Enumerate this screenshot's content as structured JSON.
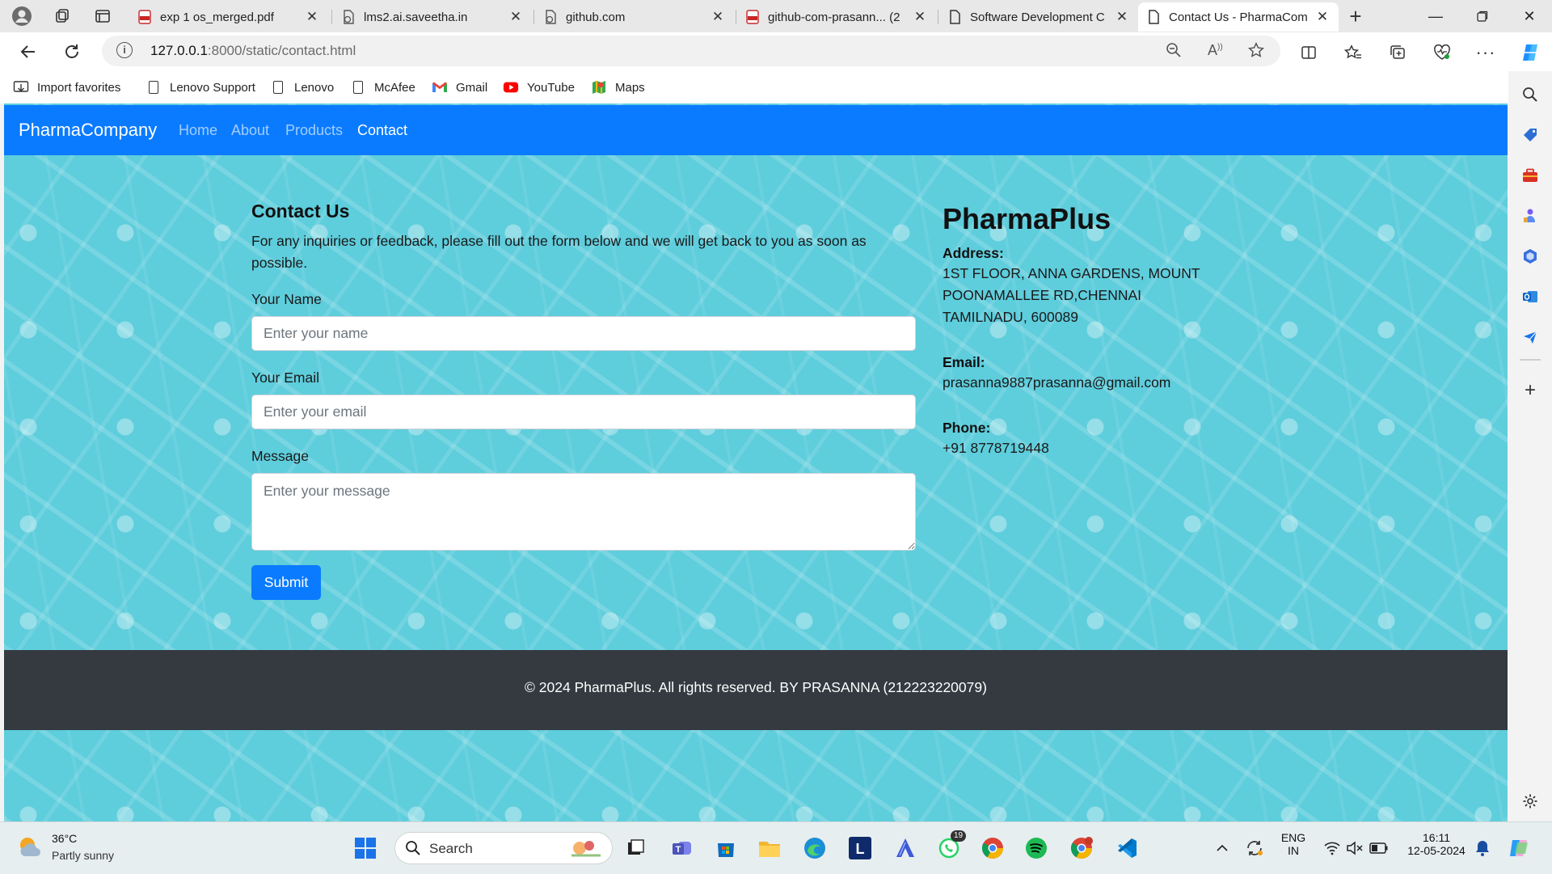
{
  "browser": {
    "tabs": [
      {
        "title": "exp 1 os_merged.pdf",
        "icon": "pdf-icon"
      },
      {
        "title": "lms2.ai.saveetha.in",
        "icon": "loading-page-icon"
      },
      {
        "title": "github.com",
        "icon": "loading-page-icon"
      },
      {
        "title": "github-com-prasann... (2",
        "icon": "pdf-icon"
      },
      {
        "title": "Software Development C",
        "icon": "page-icon"
      },
      {
        "title": "Contact Us - PharmaCom",
        "icon": "page-icon",
        "active": true
      }
    ],
    "url_host": "127.0.0.1",
    "url_rest": ":8000/static/contact.html",
    "favorites": [
      {
        "label": "Import favorites",
        "icon": "import-icon"
      },
      {
        "label": "Lenovo Support",
        "icon": "page-icon"
      },
      {
        "label": "Lenovo",
        "icon": "page-icon"
      },
      {
        "label": "McAfee",
        "icon": "page-icon"
      },
      {
        "label": "Gmail",
        "icon": "gmail-icon"
      },
      {
        "label": "YouTube",
        "icon": "youtube-icon"
      },
      {
        "label": "Maps",
        "icon": "maps-icon"
      }
    ]
  },
  "site": {
    "brand": "PharmaCompany",
    "nav": [
      "Home",
      "About",
      "Products",
      "Contact"
    ],
    "active_nav": "Contact"
  },
  "contact": {
    "title": "Contact Us",
    "description": "For any inquiries or feedback, please fill out the form below and we will get back to you as soon as possible.",
    "name_label": "Your Name",
    "name_placeholder": "Enter your name",
    "email_label": "Your Email",
    "email_placeholder": "Enter your email",
    "message_label": "Message",
    "message_placeholder": "Enter your message",
    "submit_label": "Submit"
  },
  "company": {
    "name": "PharmaPlus",
    "address_label": "Address:",
    "address_lines": [
      "1ST FLOOR, ANNA GARDENS, MOUNT",
      "POONAMALLEE RD,CHENNAI",
      "TAMILNADU, 600089"
    ],
    "email_label": "Email:",
    "email": "prasanna9887prasanna@gmail.com",
    "phone_label": "Phone:",
    "phone": "+91 8778719448"
  },
  "footer": {
    "text": "© 2024 PharmaPlus. All rights reserved. BY PRASANNA (212223220079)"
  },
  "taskbar": {
    "weather_temp": "36°C",
    "weather_desc": "Partly sunny",
    "search_label": "Search",
    "whatsapp_badge": "19",
    "lang_top": "ENG",
    "lang_bottom": "IN",
    "time": "16:11",
    "date": "12-05-2024"
  },
  "colors": {
    "navbar": "#0a7bff",
    "page_background": "#5ecddc",
    "footer": "#343a40",
    "button": "#0a7bff"
  }
}
